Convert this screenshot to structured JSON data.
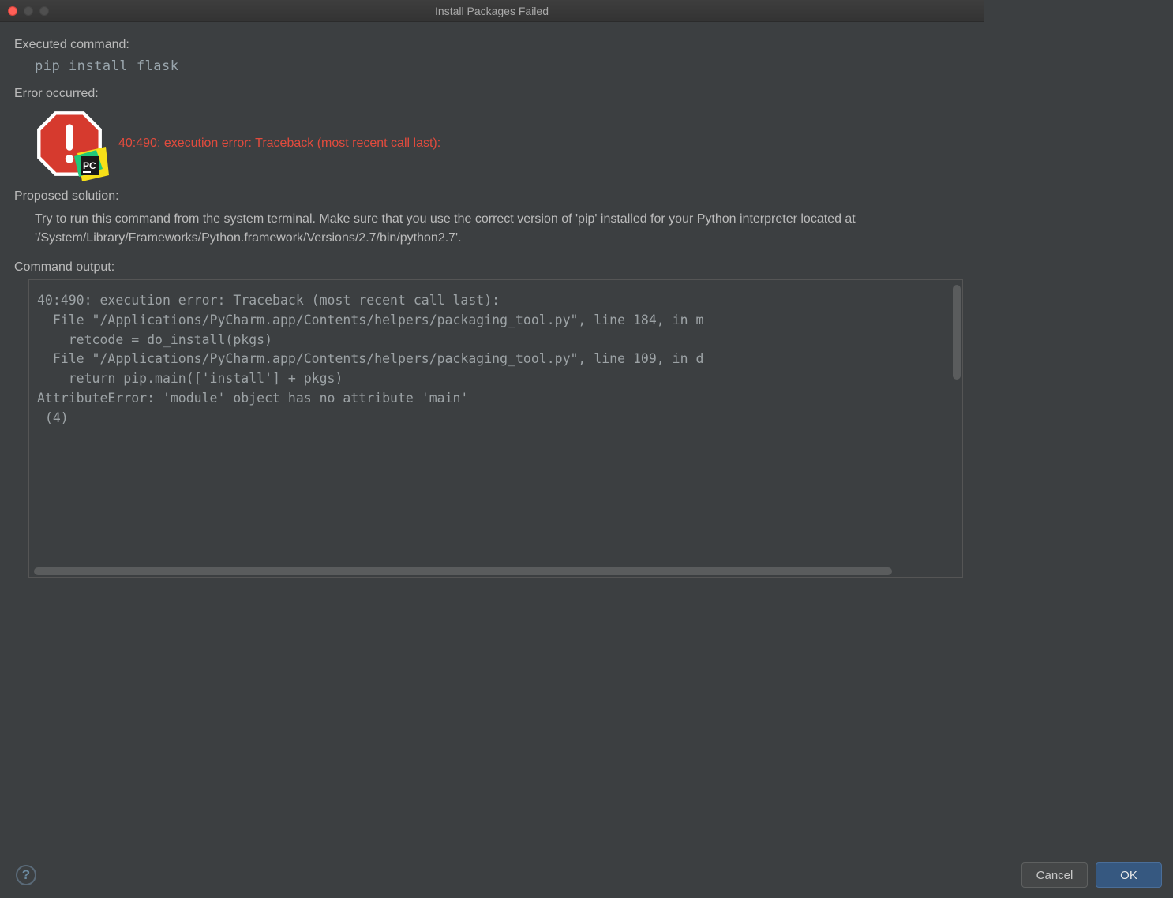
{
  "window": {
    "title": "Install Packages Failed"
  },
  "labels": {
    "executed_command": "Executed command:",
    "error_occurred": "Error occurred:",
    "proposed_solution": "Proposed solution:",
    "command_output": "Command output:"
  },
  "command": "pip install flask",
  "error_message": "40:490: execution error: Traceback (most recent call last):",
  "solution_text": "Try to run this command from the system terminal. Make sure that you use the correct version of 'pip' installed for your Python interpreter located at '/System/Library/Frameworks/Python.framework/Versions/2.7/bin/python2.7'.",
  "command_output": "40:490: execution error: Traceback (most recent call last):\n  File \"/Applications/PyCharm.app/Contents/helpers/packaging_tool.py\", line 184, in m\n    retcode = do_install(pkgs)\n  File \"/Applications/PyCharm.app/Contents/helpers/packaging_tool.py\", line 109, in d\n    return pip.main(['install'] + pkgs)\nAttributeError: 'module' object has no attribute 'main'\n (4)",
  "icons": {
    "error": "stop-error-icon",
    "app": "pycharm-icon",
    "help": "?"
  },
  "buttons": {
    "cancel": "Cancel",
    "ok": "OK"
  }
}
